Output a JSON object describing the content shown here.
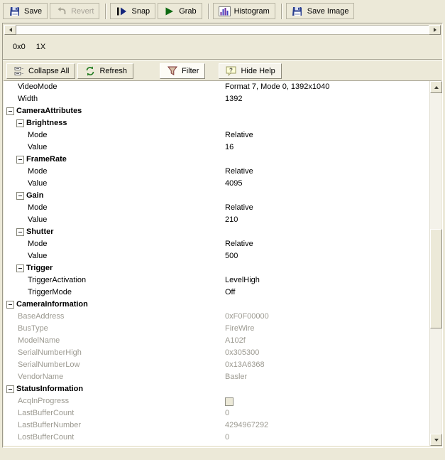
{
  "colors": {
    "window_bg": "#ece9d8",
    "grid_bg": "#ffffff",
    "border_dark": "#9d9a8b",
    "disabled_text": "#9c9a91"
  },
  "toolbar_main": {
    "buttons": [
      {
        "label": "Save",
        "icon": "floppy-disk-icon",
        "disabled": false
      },
      {
        "label": "Revert",
        "icon": "revert-arrow-icon",
        "disabled": true
      },
      {
        "label": "Snap",
        "icon": "snap-step-play-icon",
        "disabled": false
      },
      {
        "label": "Grab",
        "icon": "grab-play-icon",
        "disabled": false
      },
      {
        "label": "Histogram",
        "icon": "histogram-chart-icon",
        "disabled": false
      },
      {
        "label": "Save Image",
        "icon": "floppy-disk-icon",
        "disabled": false
      }
    ]
  },
  "image_display": {
    "size_label": "0x0",
    "zoom_label": "1X"
  },
  "toolbar_grid": {
    "buttons": [
      {
        "label": "Collapse All",
        "icon": "collapse-all-icon",
        "active": false
      },
      {
        "label": "Refresh",
        "icon": "refresh-icon",
        "active": false
      },
      {
        "label": "Filter",
        "icon": "filter-funnel-icon",
        "active": true
      },
      {
        "label": "Hide Help",
        "icon": "help-icon",
        "active": false
      }
    ]
  },
  "grid": {
    "rows": [
      {
        "type": "prop",
        "indent": 1,
        "name": "VideoMode",
        "value": "Format 7, Mode 0, 1392x1040"
      },
      {
        "type": "prop",
        "indent": 1,
        "name": "Width",
        "value": "1392"
      },
      {
        "type": "group",
        "indent": 0,
        "name": "CameraAttributes",
        "expanded": true
      },
      {
        "type": "group",
        "indent": 1,
        "name": "Brightness",
        "expanded": true
      },
      {
        "type": "prop",
        "indent": 2,
        "name": "Mode",
        "value": "Relative"
      },
      {
        "type": "prop",
        "indent": 2,
        "name": "Value",
        "value": "16"
      },
      {
        "type": "group",
        "indent": 1,
        "name": "FrameRate",
        "expanded": true
      },
      {
        "type": "prop",
        "indent": 2,
        "name": "Mode",
        "value": "Relative"
      },
      {
        "type": "prop",
        "indent": 2,
        "name": "Value",
        "value": "4095"
      },
      {
        "type": "group",
        "indent": 1,
        "name": "Gain",
        "expanded": true
      },
      {
        "type": "prop",
        "indent": 2,
        "name": "Mode",
        "value": "Relative"
      },
      {
        "type": "prop",
        "indent": 2,
        "name": "Value",
        "value": "210"
      },
      {
        "type": "group",
        "indent": 1,
        "name": "Shutter",
        "expanded": true
      },
      {
        "type": "prop",
        "indent": 2,
        "name": "Mode",
        "value": "Relative"
      },
      {
        "type": "prop",
        "indent": 2,
        "name": "Value",
        "value": "500"
      },
      {
        "type": "group",
        "indent": 1,
        "name": "Trigger",
        "expanded": true
      },
      {
        "type": "prop",
        "indent": 2,
        "name": "TriggerActivation",
        "value": "LevelHigh"
      },
      {
        "type": "prop",
        "indent": 2,
        "name": "TriggerMode",
        "value": "Off"
      },
      {
        "type": "group",
        "indent": 0,
        "name": "CameraInformation",
        "expanded": true
      },
      {
        "type": "prop",
        "indent": 1,
        "name": "BaseAddress",
        "value": "0xF0F00000",
        "disabled": true
      },
      {
        "type": "prop",
        "indent": 1,
        "name": "BusType",
        "value": "FireWire",
        "disabled": true
      },
      {
        "type": "prop",
        "indent": 1,
        "name": "ModelName",
        "value": "A102f",
        "disabled": true
      },
      {
        "type": "prop",
        "indent": 1,
        "name": "SerialNumberHigh",
        "value": "0x305300",
        "disabled": true
      },
      {
        "type": "prop",
        "indent": 1,
        "name": "SerialNumberLow",
        "value": "0x13A6368",
        "disabled": true
      },
      {
        "type": "prop",
        "indent": 1,
        "name": "VendorName",
        "value": "Basler",
        "disabled": true
      },
      {
        "type": "group",
        "indent": 0,
        "name": "StatusInformation",
        "expanded": true
      },
      {
        "type": "prop",
        "indent": 1,
        "name": "AcqInProgress",
        "value": "",
        "checkbox": true,
        "disabled": true
      },
      {
        "type": "prop",
        "indent": 1,
        "name": "LastBufferCount",
        "value": "0",
        "disabled": true
      },
      {
        "type": "prop",
        "indent": 1,
        "name": "LastBufferNumber",
        "value": "4294967292",
        "disabled": true
      },
      {
        "type": "prop",
        "indent": 1,
        "name": "LostBufferCount",
        "value": "0",
        "disabled": true
      }
    ]
  }
}
